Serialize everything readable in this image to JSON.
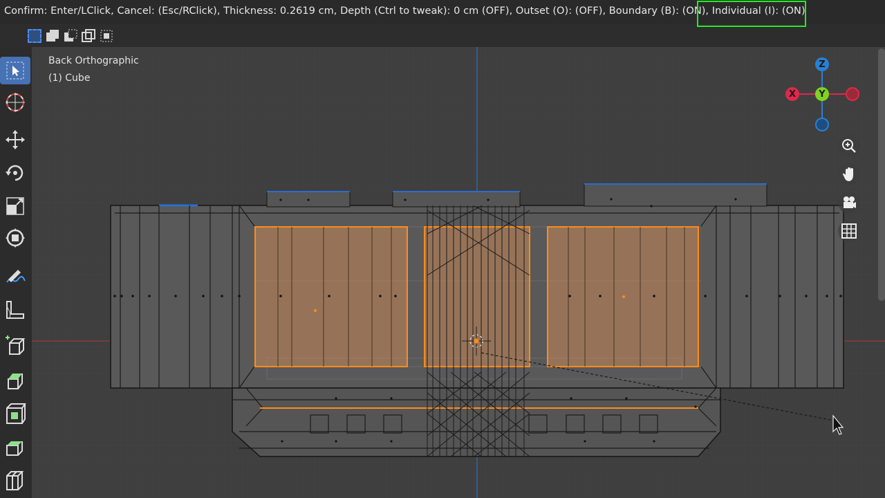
{
  "header": {
    "status_prefix": "Confirm: Enter/LClick, Cancel: (Esc/RClick), Thickness: 0.2619 cm, Depth (Ctrl to tweak): 0 cm (OFF), Outset (O): (OFF), Boundary (B): (ON), ",
    "status_highlighted": "Individual (I): (ON)"
  },
  "viewport": {
    "view_name": "Back Orthographic",
    "object_name": "(1) Cube"
  },
  "gizmo": {
    "z_label": "Z",
    "x_label": "X",
    "y_label": "Y",
    "colors": {
      "x": "#e0284a",
      "y": "#7ed321",
      "z": "#2a7fd4"
    }
  },
  "nav_buttons": [
    "zoom-icon",
    "hand-pan-icon",
    "camera-icon",
    "grid-ortho-icon"
  ],
  "tools": [
    "select-cursor-icon",
    "cursor-3d-icon",
    "move-icon",
    "rotate-icon",
    "scale-icon",
    "transform-icon",
    "annotate-icon",
    "measure-icon",
    "add-cube-icon",
    "extrude-icon",
    "inset-icon",
    "bevel-icon",
    "loop-cut-icon"
  ],
  "mode_icons": [
    "select-new-icon",
    "select-extend-icon",
    "select-subtract-icon",
    "select-invert-icon",
    "select-intersect-icon"
  ],
  "accent_color": "#4772b3",
  "selection_color": "#ff8c1a"
}
